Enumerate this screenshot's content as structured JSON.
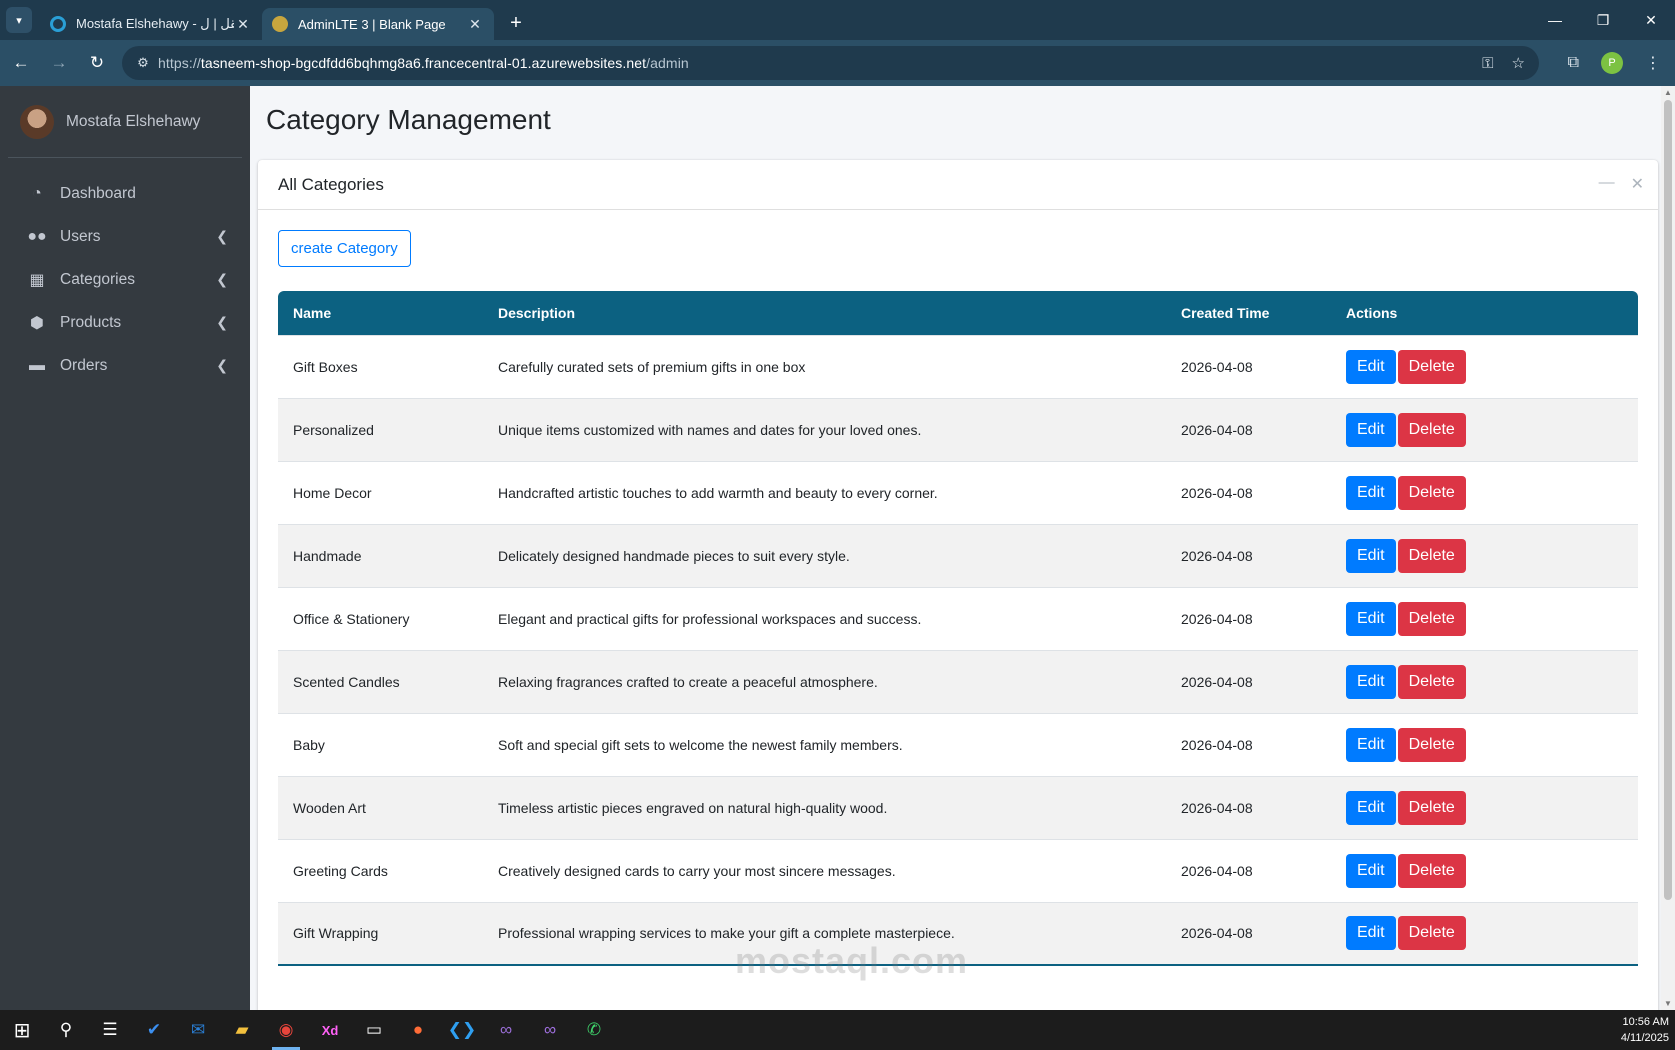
{
  "browser": {
    "tabs": [
      {
        "title": "Mostafa Elshehawy - مستقل | ل",
        "favicon_color": "#2a9fd6",
        "active": false
      },
      {
        "title": "AdminLTE 3 | Blank Page",
        "favicon_color": "#c8a63e",
        "active": true
      }
    ],
    "new_tab": "+",
    "url_scheme": "https://",
    "url_host": "tasneem-shop-bgcdfdd6bqhmg8a6.francecentral-01.azurewebsites.net",
    "url_path": "/admin",
    "profile_initial": "P"
  },
  "sidebar": {
    "user_name": "Mostafa Elshehawy",
    "items": [
      {
        "label": "Dashboard",
        "icon": "dashboard-icon",
        "glyph": "◔",
        "has_children": false
      },
      {
        "label": "Users",
        "icon": "users-icon",
        "glyph": "👥",
        "has_children": true
      },
      {
        "label": "Categories",
        "icon": "categories-icon",
        "glyph": "▦",
        "has_children": true
      },
      {
        "label": "Products",
        "icon": "products-icon",
        "glyph": "⬢",
        "has_children": true
      },
      {
        "label": "Orders",
        "icon": "orders-icon",
        "glyph": "🚚",
        "has_children": true
      }
    ]
  },
  "page": {
    "title": "Category Management",
    "card_title": "All Categories",
    "create_button": "create Category",
    "columns": [
      "Name",
      "Description",
      "Created Time",
      "Actions"
    ],
    "edit_label": "Edit",
    "delete_label": "Delete",
    "rows": [
      {
        "name": "Gift Boxes",
        "description": "Carefully curated sets of premium gifts in one box",
        "created": "2026-04-08"
      },
      {
        "name": "Personalized",
        "description": "Unique items customized with names and dates for your loved ones.",
        "created": "2026-04-08"
      },
      {
        "name": "Home Decor",
        "description": "Handcrafted artistic touches to add warmth and beauty to every corner.",
        "created": "2026-04-08"
      },
      {
        "name": "Handmade",
        "description": "Delicately designed handmade pieces to suit every style.",
        "created": "2026-04-08"
      },
      {
        "name": "Office & Stationery",
        "description": "Elegant and practical gifts for professional workspaces and success.",
        "created": "2026-04-08"
      },
      {
        "name": "Scented Candles",
        "description": "Relaxing fragrances crafted to create a peaceful atmosphere.",
        "created": "2026-04-08"
      },
      {
        "name": "Baby",
        "description": "Soft and special gift sets to welcome the newest family members.",
        "created": "2026-04-08"
      },
      {
        "name": "Wooden Art",
        "description": "Timeless artistic pieces engraved on natural high-quality wood.",
        "created": "2026-04-08"
      },
      {
        "name": "Greeting Cards",
        "description": "Creatively designed cards to carry your most sincere messages.",
        "created": "2026-04-08"
      },
      {
        "name": "Gift Wrapping",
        "description": "Professional wrapping services to make your gift a complete masterpiece.",
        "created": "2026-04-08"
      }
    ]
  },
  "watermark": "mostaql.com",
  "taskbar": {
    "time": "10:56 AM",
    "date": "4/11/2025",
    "apps": [
      "start-icon",
      "search-icon",
      "task-view-icon",
      "todo-icon",
      "outlook-icon",
      "file-explorer-icon",
      "chrome-icon",
      "adobe-xd-icon",
      "terminal-icon",
      "postman-icon",
      "vscode-icon",
      "visual-studio-icon",
      "visual-studio-preview-icon",
      "whatsapp-icon"
    ]
  },
  "colors": {
    "sidebar_bg": "#343a40",
    "table_header": "#0c6181",
    "edit_button": "#007bff",
    "delete_button": "#dc3545",
    "browser_dark": "#1f3a4d"
  }
}
